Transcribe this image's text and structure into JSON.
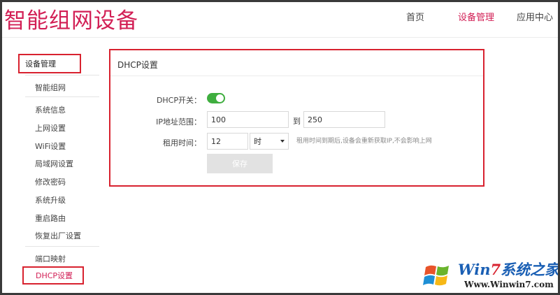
{
  "header": {
    "brand": "智能组网设备",
    "nav": [
      "首页",
      "设备管理",
      "应用中心"
    ],
    "accent_color": "#d21f55"
  },
  "sidebar": {
    "heading": "设备管理",
    "items": [
      "智能组网",
      "系统信息",
      "上网设置",
      "WiFi设置",
      "局域网设置",
      "修改密码",
      "系统升级",
      "重启路由",
      "恢复出厂设置",
      "端口映射"
    ],
    "active": "DHCP设置"
  },
  "dhcp": {
    "title": "DHCP设置",
    "switch_label": "DHCP开关：",
    "switch_on": true,
    "range_label": "IP地址范围：",
    "range_start": "100",
    "range_to": "到",
    "range_end": "250",
    "lease_label": "租用时间：",
    "lease_value": "12",
    "lease_unit": "时",
    "lease_hint": "租用时间到期后,设备会重新获取IP,不会影响上网",
    "save_label": "保存"
  },
  "watermark": {
    "title_prefix": "Win",
    "title_seven": "7",
    "title_suffix": "系统之家",
    "url": "Www.Winwin7.com"
  }
}
